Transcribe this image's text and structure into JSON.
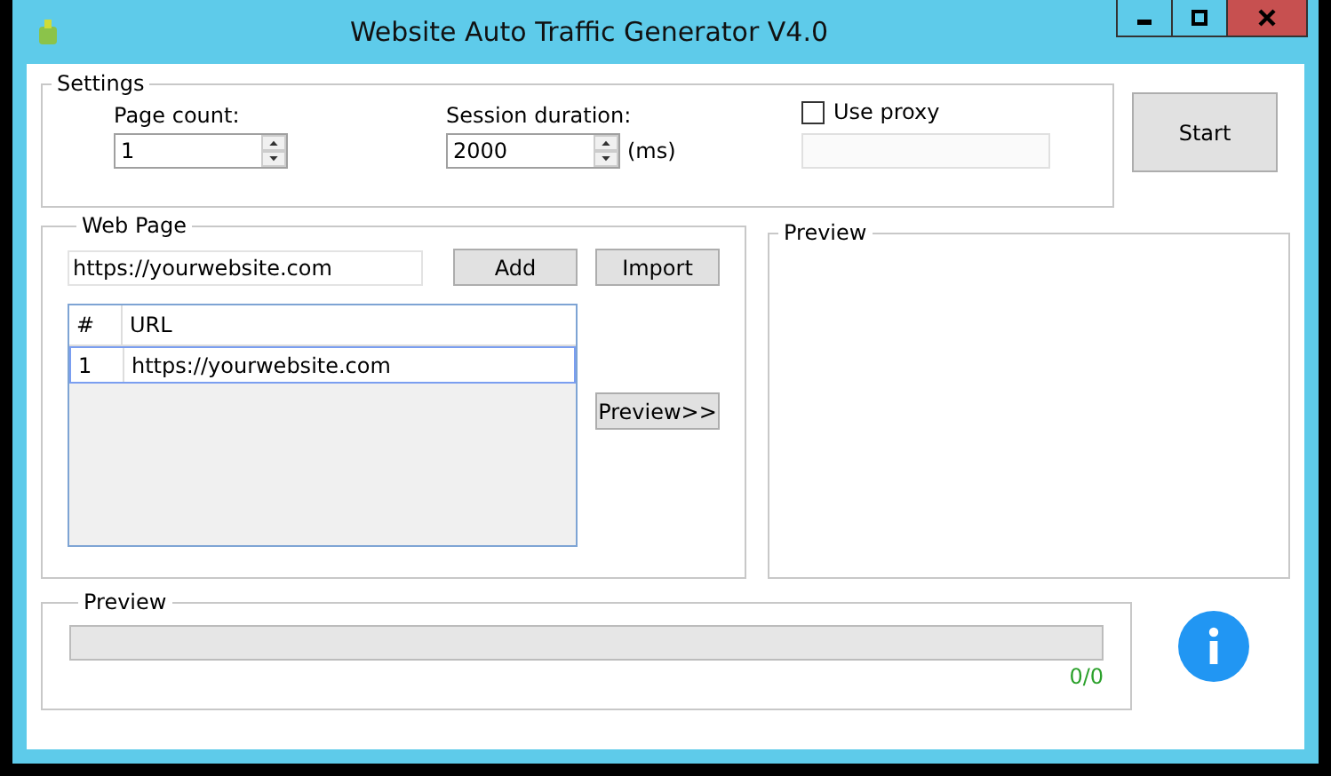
{
  "window": {
    "title": "Website Auto Traffic Generator V4.0"
  },
  "settings": {
    "legend": "Settings",
    "page_count": {
      "label": "Page count:",
      "value": "1"
    },
    "session_duration": {
      "label": "Session duration:",
      "value": "2000",
      "unit": "(ms)"
    },
    "use_proxy": {
      "label": "Use proxy",
      "checked": false
    }
  },
  "start_button": "Start",
  "web_page": {
    "legend": "Web Page",
    "url_input": "https://yourwebsite.com",
    "buttons": [
      "Add",
      "Import"
    ],
    "preview_button": "Preview>>",
    "table": {
      "columns": [
        "#",
        "URL"
      ],
      "rows": [
        {
          "cells": [
            "1",
            "https://yourwebsite.com"
          ],
          "selected": true
        }
      ]
    }
  },
  "preview_panel": {
    "legend": "Preview"
  },
  "progress": {
    "legend": "Preview",
    "level": 0,
    "count": "0/0"
  }
}
